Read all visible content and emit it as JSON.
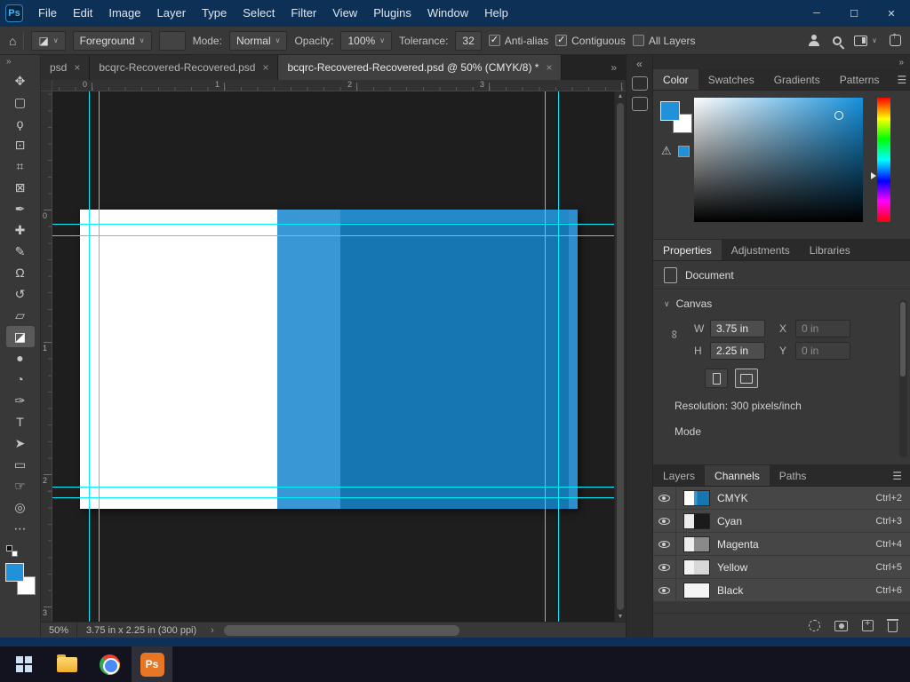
{
  "window": {
    "logo": "Ps",
    "minimize": "─",
    "maximize": "☐",
    "close": "✕"
  },
  "menubar": [
    "File",
    "Edit",
    "Image",
    "Layer",
    "Type",
    "Select",
    "Filter",
    "View",
    "Plugins",
    "Window",
    "Help"
  ],
  "icons": {
    "home": "⌂",
    "chevron": "∨",
    "tab_overflow": "»",
    "toolbar_overflow": "»",
    "dock_collapse": "«",
    "dock_expand": "»",
    "panel_menu": "☰",
    "warning": "⚠",
    "scroll_up": "▲",
    "scroll_down": "▼",
    "status_flyout": "›",
    "link": "∞"
  },
  "options": {
    "tool_glyph": "◪",
    "fill": "Foreground",
    "mode_label": "Mode:",
    "mode": "Normal",
    "opacity_label": "Opacity:",
    "opacity": "100%",
    "tolerance_label": "Tolerance:",
    "tolerance": "32",
    "anti_alias": "Anti-alias",
    "contiguous": "Contiguous",
    "all_layers": "All Layers"
  },
  "tabs": [
    {
      "label": "psd",
      "close": "×"
    },
    {
      "label": "bcqrc-Recovered-Recovered.psd",
      "close": "×"
    },
    {
      "label": "bcqrc-Recovered-Recovered.psd @ 50% (CMYK/8) *",
      "close": "×"
    }
  ],
  "tools": [
    {
      "name": "move",
      "glyph": "✥"
    },
    {
      "name": "rectangular-marquee",
      "glyph": "▢"
    },
    {
      "name": "lasso",
      "glyph": "ϙ"
    },
    {
      "name": "object-selection",
      "glyph": "⊡"
    },
    {
      "name": "crop",
      "glyph": "⌗"
    },
    {
      "name": "frame",
      "glyph": "⊠"
    },
    {
      "name": "eyedropper",
      "glyph": "✒"
    },
    {
      "name": "spot-healing-brush",
      "glyph": "✚"
    },
    {
      "name": "brush",
      "glyph": "✎"
    },
    {
      "name": "clone-stamp",
      "glyph": "Ω"
    },
    {
      "name": "history-brush",
      "glyph": "↺"
    },
    {
      "name": "eraser",
      "glyph": "▱"
    },
    {
      "name": "paint-bucket",
      "glyph": "◪"
    },
    {
      "name": "blur",
      "glyph": "●"
    },
    {
      "name": "dodge",
      "glyph": "◔"
    },
    {
      "name": "pen",
      "glyph": "✑"
    },
    {
      "name": "type",
      "glyph": "T"
    },
    {
      "name": "path-selection",
      "glyph": "➤"
    },
    {
      "name": "rectangle",
      "glyph": "▭"
    },
    {
      "name": "hand",
      "glyph": "☞"
    },
    {
      "name": "zoom",
      "glyph": "◎"
    },
    {
      "name": "more",
      "glyph": "⋯"
    }
  ],
  "rulers": {
    "h": [
      "0",
      "1",
      "2",
      "3"
    ],
    "v": [
      "0",
      "1",
      "2",
      "3"
    ]
  },
  "status": {
    "zoom": "50%",
    "info": "3.75 in x 2.25 in (300 ppi)"
  },
  "color_panel": {
    "tabs": [
      "Color",
      "Swatches",
      "Gradients",
      "Patterns"
    ]
  },
  "properties": {
    "tabs": [
      "Properties",
      "Adjustments",
      "Libraries"
    ],
    "document": "Document",
    "canvas": "Canvas",
    "w_label": "W",
    "w": "3.75 in",
    "x_label": "X",
    "x": "0 in",
    "h_label": "H",
    "h": "2.25 in",
    "y_label": "Y",
    "y": "0 in",
    "resolution": "Resolution: 300 pixels/inch",
    "mode": "Mode"
  },
  "channels": {
    "tabs": [
      "Layers",
      "Channels",
      "Paths"
    ],
    "rows": [
      {
        "name": "CMYK",
        "key": "Ctrl+2"
      },
      {
        "name": "Cyan",
        "key": "Ctrl+3"
      },
      {
        "name": "Magenta",
        "key": "Ctrl+4"
      },
      {
        "name": "Yellow",
        "key": "Ctrl+5"
      },
      {
        "name": "Black",
        "key": "Ctrl+6"
      }
    ]
  },
  "taskbar": {
    "ps": "Ps"
  },
  "colors": {
    "foreground": "#2191d9",
    "doc_blue": "#1576b2",
    "doc_blue_stripe": "#3a97d5",
    "guide": "#00f0ff",
    "titlebar": "#0d3156",
    "taskbar": "#13131f"
  }
}
